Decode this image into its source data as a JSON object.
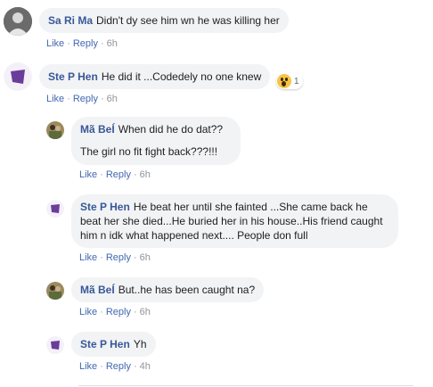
{
  "comments": [
    {
      "author": "Sa Ri Ma",
      "text": "Didn't dy see him wn he was killing her",
      "like": "Like",
      "reply": "Reply",
      "time": "6h",
      "avatar_icon": "profile-photo-dark"
    },
    {
      "author": "Ste P Hen",
      "text": "He did it ...Codedely no one knew",
      "like": "Like",
      "reply": "Reply",
      "time": "6h",
      "avatar_icon": "profile-photo-purple",
      "reaction": {
        "icon": "wow-reaction-icon",
        "count": "1"
      }
    },
    {
      "author": "Mã BeÍ",
      "text": "When did he do dat??",
      "text2": "The girl no fit fight back???!!!",
      "like": "Like",
      "reply": "Reply",
      "time": "6h",
      "avatar_icon": "profile-photo-couple"
    },
    {
      "author": "Ste P Hen",
      "text": "He beat her until she fainted ...She came back he beat her she died...He buried her in his house..His friend caught him n idk what happened next.... People don full",
      "like": "Like",
      "reply": "Reply",
      "time": "6h",
      "avatar_icon": "profile-photo-purple"
    },
    {
      "author": "Mã BeÍ",
      "text": "But..he has been caught na?",
      "like": "Like",
      "reply": "Reply",
      "time": "6h",
      "avatar_icon": "profile-photo-couple"
    },
    {
      "author": "Ste P Hen",
      "text": "Yh",
      "like": "Like",
      "reply": "Reply",
      "time": "4h",
      "avatar_icon": "profile-photo-purple"
    }
  ],
  "colors": {
    "bubble": "#f2f3f5",
    "author": "#385898",
    "link": "#4267b2",
    "meta": "#90949c"
  }
}
